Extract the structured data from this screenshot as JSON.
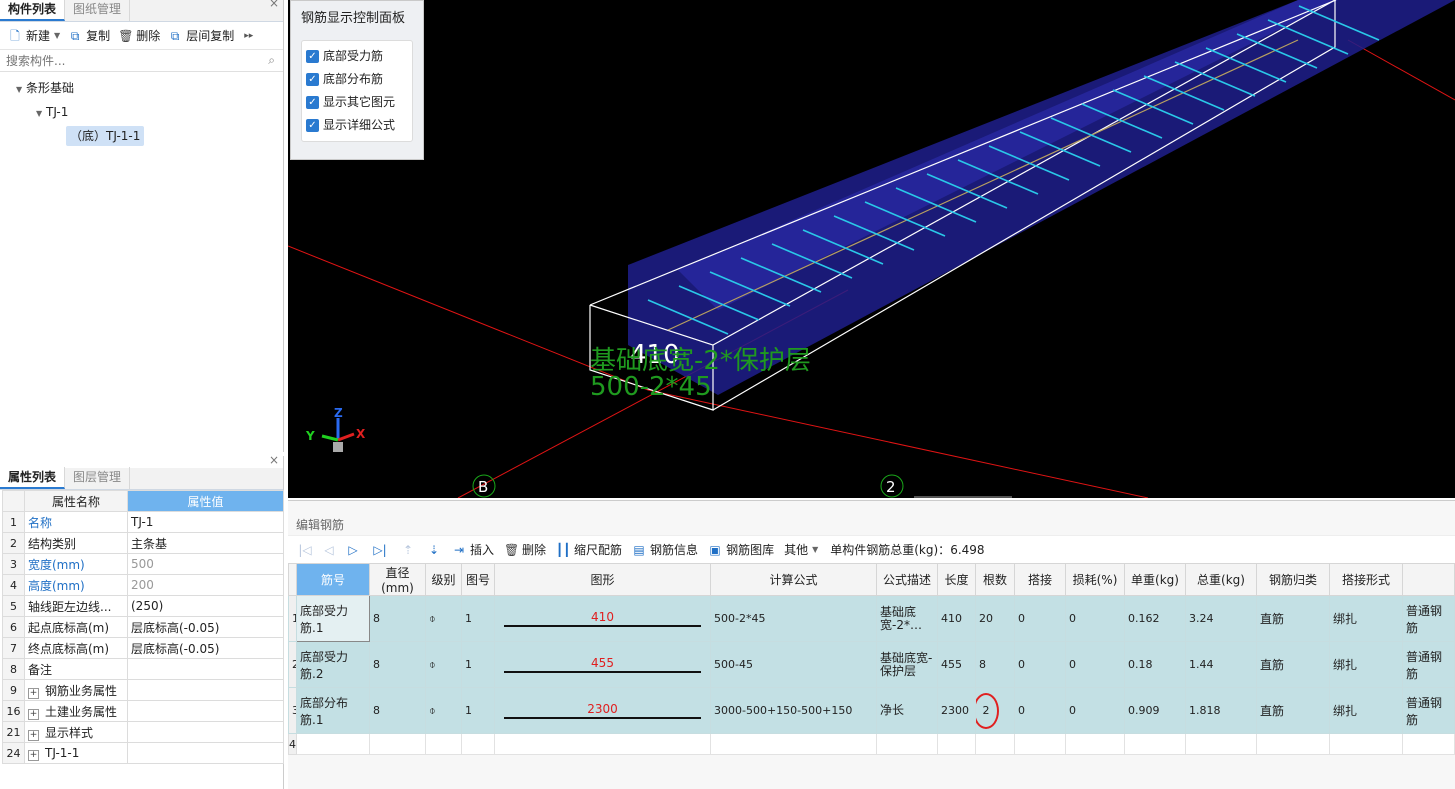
{
  "left_top": {
    "tabs": [
      "构件列表",
      "图纸管理"
    ],
    "toolbar": {
      "new": "新建",
      "copy": "复制",
      "delete": "删除",
      "floor_copy": "层间复制"
    },
    "search_placeholder": "搜索构件...",
    "tree": {
      "root": "条形基础",
      "child": "TJ-1",
      "leaf": "（底）TJ-1-1"
    }
  },
  "left_bottom": {
    "tabs": [
      "属性列表",
      "图层管理"
    ],
    "headers": [
      "属性名称",
      "属性值"
    ],
    "rows": [
      {
        "idx": "1",
        "name": "名称",
        "value": "TJ-1"
      },
      {
        "idx": "2",
        "name": "结构类别",
        "value": "主条基"
      },
      {
        "idx": "3",
        "name": "宽度(mm)",
        "value": "500"
      },
      {
        "idx": "4",
        "name": "高度(mm)",
        "value": "200"
      },
      {
        "idx": "5",
        "name": "轴线距左边线...",
        "value": "(250)"
      },
      {
        "idx": "6",
        "name": "起点底标高(m)",
        "value": "层底标高(-0.05)"
      },
      {
        "idx": "7",
        "name": "终点底标高(m)",
        "value": "层底标高(-0.05)"
      },
      {
        "idx": "8",
        "name": "备注",
        "value": ""
      },
      {
        "idx": "9",
        "name": "钢筋业务属性",
        "value": ""
      },
      {
        "idx": "16",
        "name": "土建业务属性",
        "value": ""
      },
      {
        "idx": "21",
        "name": "显示样式",
        "value": ""
      },
      {
        "idx": "24",
        "name": "TJ-1-1",
        "value": ""
      }
    ]
  },
  "control_panel": {
    "title": "钢筋显示控制面板",
    "options": [
      "底部受力筋",
      "底部分布筋",
      "显示其它图元",
      "显示详细公式"
    ]
  },
  "viewport": {
    "dim_label": "410",
    "formula_line1": "基础底宽-2*保护层",
    "formula_line2": "500-2*45",
    "axis_b": "B",
    "axis_2": "2",
    "x": "X",
    "y": "Y",
    "z": "Z"
  },
  "rebar": {
    "title": "编辑钢筋",
    "toolbar": {
      "insert": "插入",
      "delete": "删除",
      "scale": "缩尺配筋",
      "info": "钢筋信息",
      "library": "钢筋图库",
      "other": "其他"
    },
    "total_label": "单构件钢筋总重(kg)：",
    "total_value": "6.498",
    "headers": [
      "筋号",
      "直径(mm)",
      "级别",
      "图号",
      "图形",
      "计算公式",
      "公式描述",
      "长度",
      "根数",
      "搭接",
      "损耗(%)",
      "单重(kg)",
      "总重(kg)",
      "钢筋归类",
      "搭接形式"
    ],
    "rows": [
      {
        "idx": "1",
        "name": "底部受力筋.1",
        "dia": "8",
        "grade": "⌽",
        "fig": "1",
        "shape": "410",
        "formula": "500-2*45",
        "desc": "基础底宽-2*…",
        "len": "410",
        "count": "20",
        "lap": "0",
        "loss": "0",
        "unit": "0.162",
        "total": "3.24",
        "cls": "直筋",
        "lapform": "绑扎",
        "type": "普通钢筋"
      },
      {
        "idx": "2",
        "name": "底部受力筋.2",
        "dia": "8",
        "grade": "⌽",
        "fig": "1",
        "shape": "455",
        "formula": "500-45",
        "desc": "基础底宽-保护层",
        "len": "455",
        "count": "8",
        "lap": "0",
        "loss": "0",
        "unit": "0.18",
        "total": "1.44",
        "cls": "直筋",
        "lapform": "绑扎",
        "type": "普通钢筋"
      },
      {
        "idx": "3",
        "name": "底部分布筋.1",
        "dia": "8",
        "grade": "⌽",
        "fig": "1",
        "shape": "2300",
        "formula": "3000-500+150-500+150",
        "desc": "净长",
        "len": "2300",
        "count": "2",
        "lap": "0",
        "loss": "0",
        "unit": "0.909",
        "total": "1.818",
        "cls": "直筋",
        "lapform": "绑扎",
        "type": "普通钢筋"
      }
    ],
    "empty_idx": "4"
  },
  "colors": {
    "accent": "#2a7ad0",
    "row_bg": "#c3e0e4",
    "shape_text": "#e02020",
    "viewport_bg": "#000000"
  }
}
